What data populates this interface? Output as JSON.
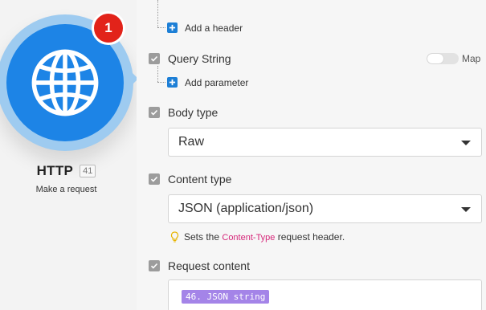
{
  "module": {
    "name": "HTTP",
    "id": "41",
    "subtitle": "Make a request",
    "badge_count": "1",
    "icon": "globe-icon"
  },
  "headers": {
    "add_label": "Add a header"
  },
  "query_string": {
    "label": "Query String",
    "map_label": "Map",
    "add_label": "Add parameter"
  },
  "body_type": {
    "label": "Body type",
    "value": "Raw"
  },
  "content_type": {
    "label": "Content type",
    "value": "JSON (application/json)",
    "hint_prefix": "Sets the ",
    "hint_code": "Content-Type",
    "hint_suffix": " request header."
  },
  "request_content": {
    "label": "Request content",
    "pill": "46. JSON string"
  },
  "colors": {
    "module_blue": "#1d84e6",
    "badge_red": "#e2231a",
    "pill_purple": "#a484e8",
    "link_blue": "#1d7fd6",
    "hint_pink": "#d6277a"
  }
}
